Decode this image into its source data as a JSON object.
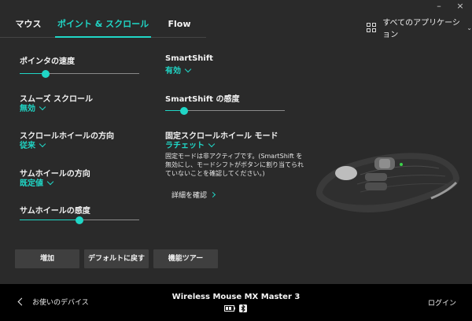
{
  "window": {
    "minimize": "–",
    "close": "×"
  },
  "tabs": [
    {
      "label": "マウス",
      "active": false
    },
    {
      "label": "ポイント & スクロール",
      "active": true
    },
    {
      "label": "Flow",
      "active": false
    }
  ],
  "app_selector": {
    "label": "すべてのアプリケーション",
    "icon": "grid-icon"
  },
  "settings_left": {
    "pointer_speed": {
      "label": "ポインタの速度",
      "level": 0.22
    },
    "smooth_scroll": {
      "label": "スムーズ スクロール",
      "value": "無効"
    },
    "scroll_direction": {
      "label": "スクロールホイールの方向",
      "value": "従来"
    },
    "thumb_direction": {
      "label": "サムホイールの方向",
      "value": "既定値"
    },
    "thumb_sensitivity": {
      "label": "サムホイールの感度",
      "level": 0.5
    }
  },
  "settings_right": {
    "smartshift": {
      "label": "SmartShift",
      "value": "有効"
    },
    "smartshift_sensitivity": {
      "label": "SmartShift の感度",
      "level": 0.16
    },
    "fixed_mode": {
      "label": "固定スクロールホイール モード",
      "value": "ラチェット"
    },
    "description": "固定モードは非アクティブです。(SmartShift を無効にし、モードシフトがボタンに割り当てられていないことを確認してください。)",
    "learn_more": "詳細を確認"
  },
  "buttons": {
    "add": "増加",
    "reset": "デフォルトに戻す",
    "tour": "機能ツアー"
  },
  "footer": {
    "back": "お使いのデバイス",
    "device": "Wireless Mouse MX Master 3",
    "login": "ログイン"
  },
  "colors": {
    "accent": "#20d6c6",
    "background": "#2a2a2a",
    "footer": "#000000",
    "button": "#3f3f3f"
  }
}
